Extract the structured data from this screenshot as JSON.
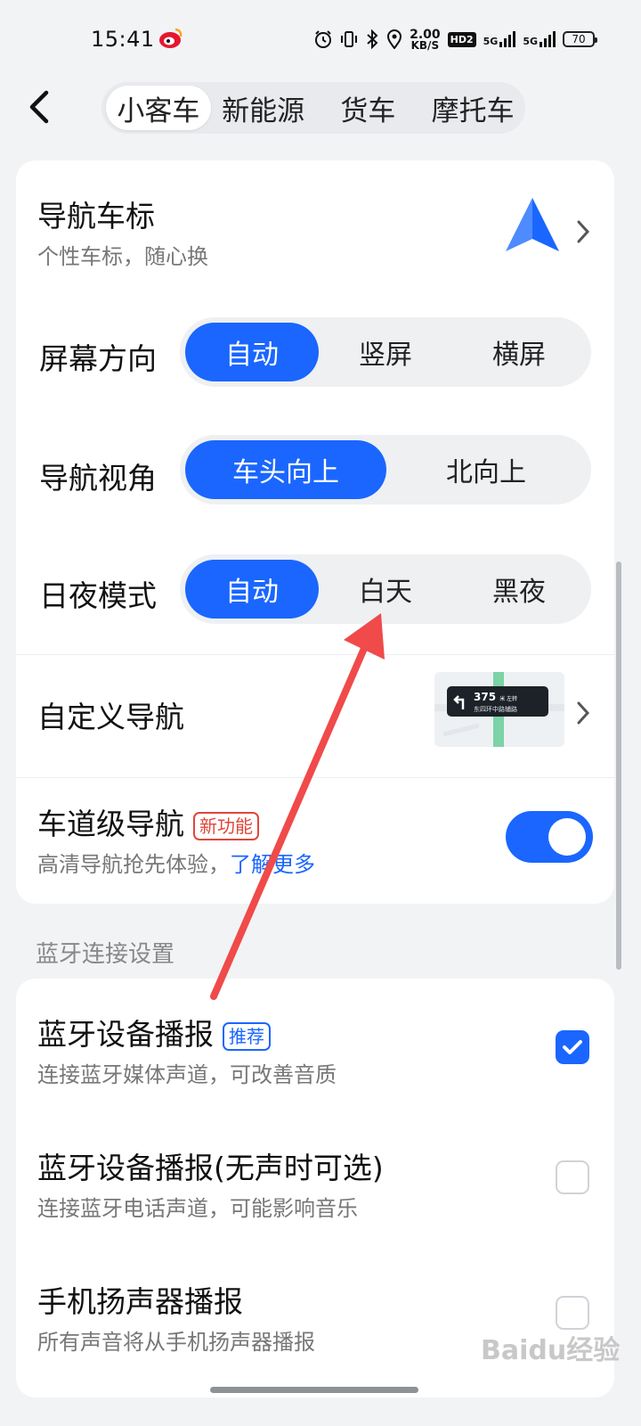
{
  "status_bar": {
    "time": "15:41",
    "speed_value": "2.00",
    "speed_unit": "KB/S",
    "hd_label": "HD2",
    "net1": "5G",
    "net2": "5G",
    "battery": "70"
  },
  "header": {
    "tabs": [
      {
        "label": "小客车",
        "active": true
      },
      {
        "label": "新能源",
        "active": false
      },
      {
        "label": "货车",
        "active": false
      },
      {
        "label": "摩托车",
        "active": false
      }
    ]
  },
  "card1": {
    "car_icon": {
      "title": "导航车标",
      "subtitle": "个性车标，随心换"
    },
    "screen_orientation": {
      "label": "屏幕方向",
      "options": [
        "自动",
        "竖屏",
        "横屏"
      ],
      "selected": "自动"
    },
    "nav_view": {
      "label": "导航视角",
      "options": [
        "车头向上",
        "北向上"
      ],
      "selected": "车头向上"
    },
    "day_night": {
      "label": "日夜模式",
      "options": [
        "自动",
        "白天",
        "黑夜"
      ],
      "selected": "自动"
    },
    "custom_nav": {
      "title": "自定义导航",
      "preview_distance": "375",
      "preview_unit": "米 左转",
      "preview_road": "东四环中路辅路"
    },
    "lane_nav": {
      "title": "车道级导航",
      "badge": "新功能",
      "subtitle": "高清导航抢先体验，",
      "link": "了解更多",
      "enabled": true
    }
  },
  "bluetooth": {
    "section_title": "蓝牙连接设置",
    "items": [
      {
        "title": "蓝牙设备播报",
        "badge": "推荐",
        "subtitle": "连接蓝牙媒体声道，可改善音质",
        "checked": true
      },
      {
        "title": "蓝牙设备播报(无声时可选)",
        "subtitle": "连接蓝牙电话声道，可能影响音乐",
        "checked": false
      },
      {
        "title": "手机扬声器播报",
        "subtitle": "所有声音将从手机扬声器播报",
        "checked": false
      }
    ]
  },
  "watermark": "Baidu经验",
  "colors": {
    "accent": "#1a66ff",
    "badge_red": "#e0463b",
    "annotation_arrow": "#f04a4a"
  }
}
